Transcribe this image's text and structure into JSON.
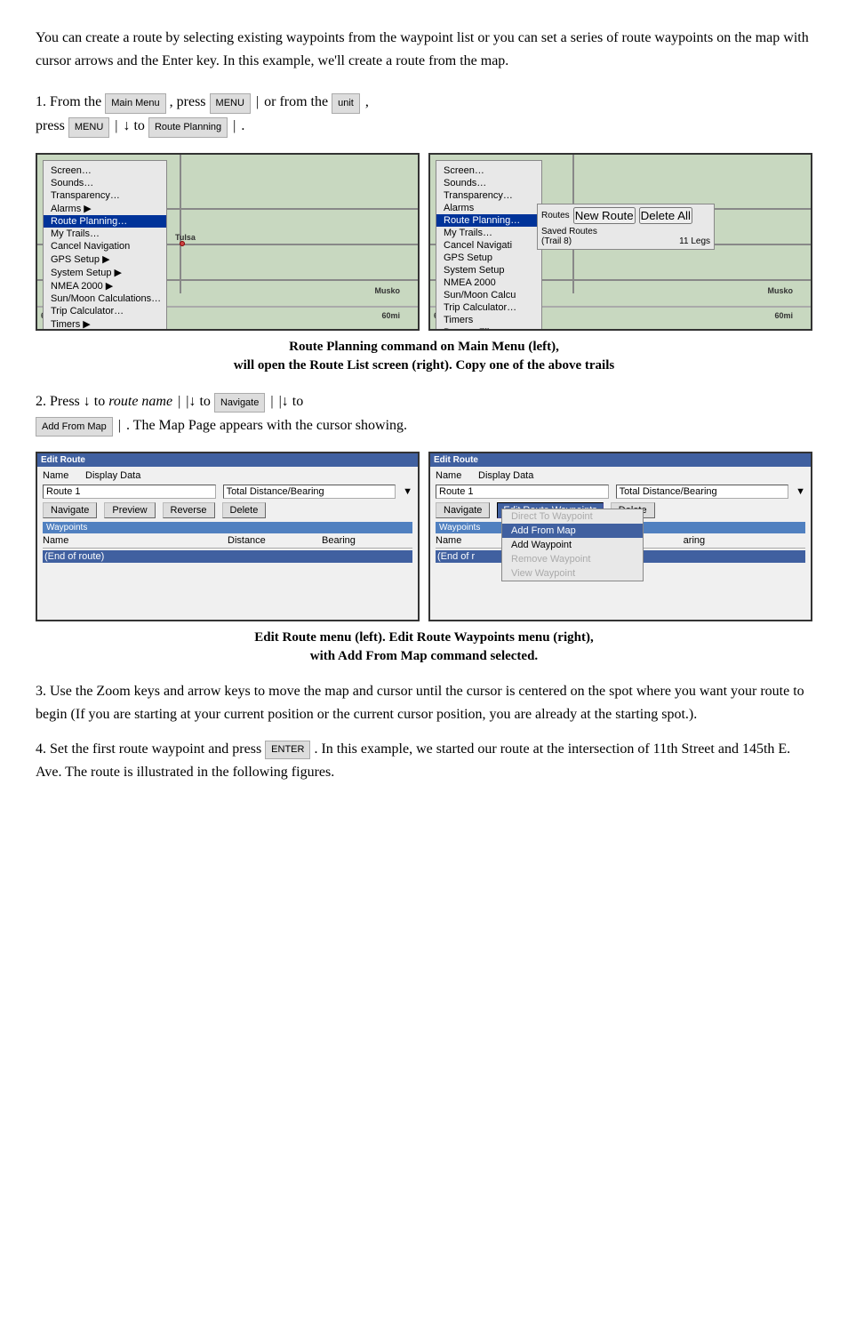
{
  "intro": {
    "text": "You can create a route by selecting existing waypoints from the waypoint list or you can set a series of route waypoints on the map with cursor arrows and the Enter key. In this example, we'll create a route from the map."
  },
  "step1": {
    "number": "1.",
    "text_a": "From the",
    "text_b": ", press",
    "text_c": "or from the",
    "text_d": ", press",
    "text_e": "↓ to",
    "text_f": "."
  },
  "screenshot_caption_1": {
    "line1": "Route Planning command on Main Menu (left),",
    "line2": "will open the Route List screen (right). Copy one of the above trails"
  },
  "step2": {
    "number": "2.",
    "text_a": "Press ↓ to",
    "italic": "route name",
    "text_b": "|",
    "text_c": "|↓ to",
    "text_d": "|",
    "text_e": "|↓ to",
    "text_f": "|",
    "text_g": ". The Map Page appears with the cursor showing."
  },
  "edit_route_left": {
    "title": "Edit Route",
    "name_label": "Name",
    "display_label": "Display Data",
    "name_value": "Route 1",
    "display_value": "Total Distance/Bearing",
    "btn_navigate": "Navigate",
    "btn_preview": "Preview",
    "btn_reverse": "Reverse",
    "btn_delete": "Delete",
    "waypoints_header": "Waypoints",
    "col_name": "Name",
    "col_distance": "Distance",
    "col_bearing": "Bearing",
    "row1": "(End of route)"
  },
  "edit_route_right": {
    "title": "Edit Route",
    "name_label": "Name",
    "display_label": "Display Data",
    "name_value": "Route 1",
    "display_value": "Total Distance/Bearing",
    "btn_navigate": "Navigate",
    "waypoints_label": "Edit Route Waypoints",
    "btn_delete": "Delete",
    "waypoints_header": "Waypoints",
    "col_name": "Name",
    "col_bearing": "aring",
    "row1": "(End of r",
    "popup_items": [
      {
        "label": "Direct To Waypoint",
        "type": "disabled"
      },
      {
        "label": "Add From Map",
        "type": "highlighted"
      },
      {
        "label": "Add Waypoint",
        "type": "normal"
      },
      {
        "label": "Remove Waypoint",
        "type": "disabled"
      },
      {
        "label": "View Waypoint",
        "type": "disabled"
      }
    ]
  },
  "caption_2": {
    "line1": "Edit Route menu (left). Edit Route Waypoints menu (right),",
    "line2": "with Add From Map command selected."
  },
  "step3": {
    "number": "3.",
    "text": "Use the Zoom keys and arrow keys to move the map and cursor until the cursor is centered on the spot where you want your route to begin (If you are starting at your current position or the current cursor position, you are already at the starting spot.)."
  },
  "step4": {
    "number": "4.",
    "text_a": "Set the first route waypoint and press",
    "text_b": ". In this example, we started our route at the intersection of 11th Street and 145th E. Ave. The route is illustrated in the following figures."
  },
  "menu_items_left": [
    "Screen…",
    "Sounds…",
    "Transparency…",
    "Alarms",
    "Route Planning…",
    "My Trails…",
    "Cancel Navigation",
    "GPS Setup",
    "System Setup",
    "NMEA 2000",
    "Sun/Moon Calculations…",
    "Trip Calculator…",
    "Timers",
    "Browse Files…"
  ],
  "route_list_label": "Routes",
  "route_new_btn": "New Route",
  "route_delete_btn": "Delete All",
  "saved_routes_label": "Saved Routes",
  "trail_label": "(Trail 8)",
  "legs_label": "11 Legs"
}
